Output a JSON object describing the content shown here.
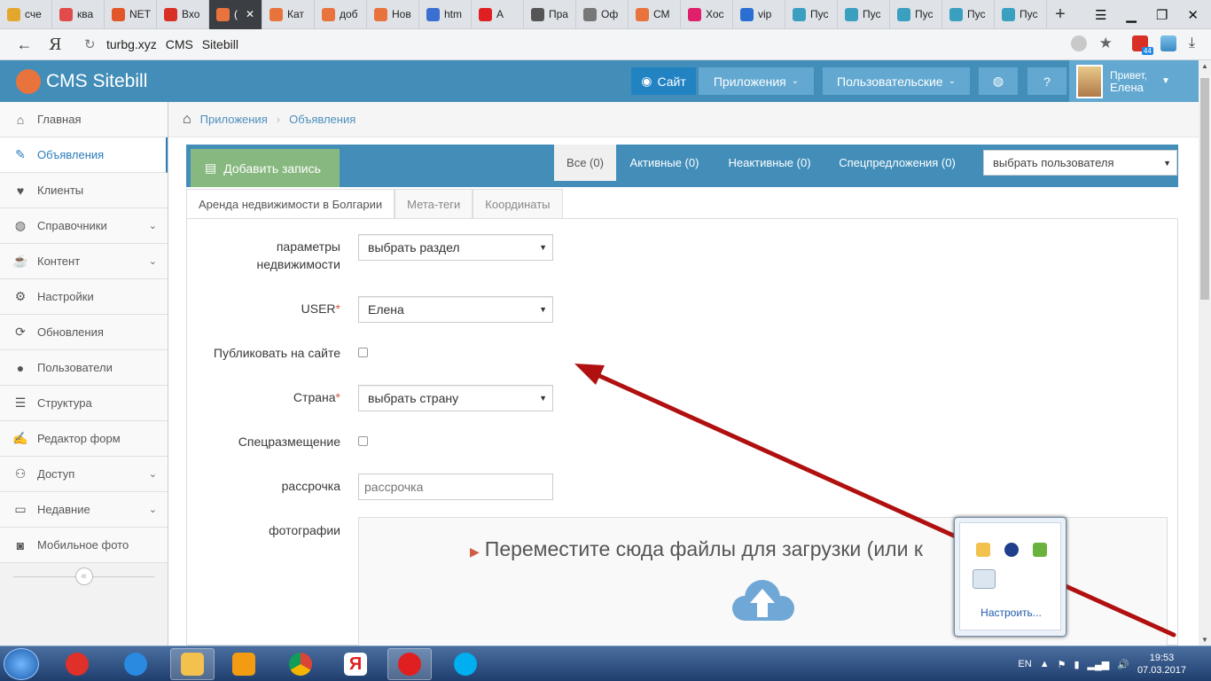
{
  "browser": {
    "tabs": [
      {
        "label": "сче",
        "color": "#e4a72d"
      },
      {
        "label": "ква",
        "color": "#e24b4b"
      },
      {
        "label": "NET",
        "color": "#e2562a"
      },
      {
        "label": "Вхо",
        "color": "#d93025"
      },
      {
        "label": "(",
        "color": "#e8733c",
        "active": true
      },
      {
        "label": "Кат",
        "color": "#e8733c"
      },
      {
        "label": "доб",
        "color": "#e8733c"
      },
      {
        "label": "Нов",
        "color": "#e8733c"
      },
      {
        "label": "htm",
        "color": "#3b6fd1"
      },
      {
        "label": "А",
        "color": "#e02020"
      },
      {
        "label": "Пра",
        "color": "#555555"
      },
      {
        "label": "Оф",
        "color": "#777777"
      },
      {
        "label": "СМ",
        "color": "#e8733c"
      },
      {
        "label": "Хос",
        "color": "#e0206a"
      },
      {
        "label": "vip",
        "color": "#2a6fd1"
      },
      {
        "label": "Пус",
        "color": "#3ba0c0"
      },
      {
        "label": "Пус",
        "color": "#3ba0c0"
      },
      {
        "label": "Пус",
        "color": "#3ba0c0"
      },
      {
        "label": "Пус",
        "color": "#3ba0c0"
      },
      {
        "label": "Пус",
        "color": "#3ba0c0"
      }
    ],
    "tab_close": "✕",
    "new_tab": "+",
    "address": {
      "domain": "turbg.xyz",
      "title": "CMS Sitebill",
      "badge": "44"
    }
  },
  "header": {
    "brand": "CMS Sitebill",
    "site_label": "Сайт",
    "apps_label": "Приложения",
    "users_label": "Пользовательские",
    "greeting": "Привет,",
    "user_name": "Елена"
  },
  "sidebar": {
    "items": [
      {
        "label": "Главная",
        "icon": "⌂"
      },
      {
        "label": "Объявления",
        "icon": "✎",
        "active": true
      },
      {
        "label": "Клиенты",
        "icon": "♥"
      },
      {
        "label": "Справочники",
        "icon": "◍",
        "chevron": true
      },
      {
        "label": "Контент",
        "icon": "☕",
        "chevron": true
      },
      {
        "label": "Настройки",
        "icon": "⚙"
      },
      {
        "label": "Обновления",
        "icon": "⟳"
      },
      {
        "label": "Пользователи",
        "icon": "●"
      },
      {
        "label": "Структура",
        "icon": "☰"
      },
      {
        "label": "Редактор форм",
        "icon": "✍"
      },
      {
        "label": "Доступ",
        "icon": "⚇",
        "chevron": true
      },
      {
        "label": "Недавние",
        "icon": "▭",
        "chevron": true
      },
      {
        "label": "Мобильное фото",
        "icon": "◙"
      }
    ],
    "collapse": "«"
  },
  "breadcrumb": {
    "items": [
      "Приложения",
      "Объявления"
    ]
  },
  "toolbar": {
    "add_label": "Добавить запись",
    "filters": {
      "all": "Все (0)",
      "active": "Активные (0)",
      "inactive": "Неактивные (0)",
      "special": "Спецпредложения (0)"
    },
    "user_select": "выбрать пользователя"
  },
  "subtabs": [
    "Аренда недвижимости в Болгарии",
    "Мета-теги",
    "Координаты"
  ],
  "form": {
    "params_label_1": "параметры",
    "params_label_2": "недвижимости",
    "params_value": "выбрать раздел",
    "user_label": "USER",
    "user_value": "Елена",
    "publish_label": "Публиковать на сайте",
    "country_label": "Страна",
    "country_value": "выбрать страну",
    "special_label": "Спецразмещение",
    "installment_label": "рассрочка",
    "installment_placeholder": "рассрочка",
    "photos_label": "фотографии",
    "dropzone_text": "Переместите сюда файлы для загрузки (или к"
  },
  "tray": {
    "configure": "Настроить..."
  },
  "taskbar": {
    "lang": "EN",
    "time": "19:53",
    "date": "07.03.2017"
  },
  "colors": {
    "header": "#438eb9",
    "accent": "#2b7dbc",
    "add_button": "#87b87f",
    "arrow": "#b01010"
  }
}
